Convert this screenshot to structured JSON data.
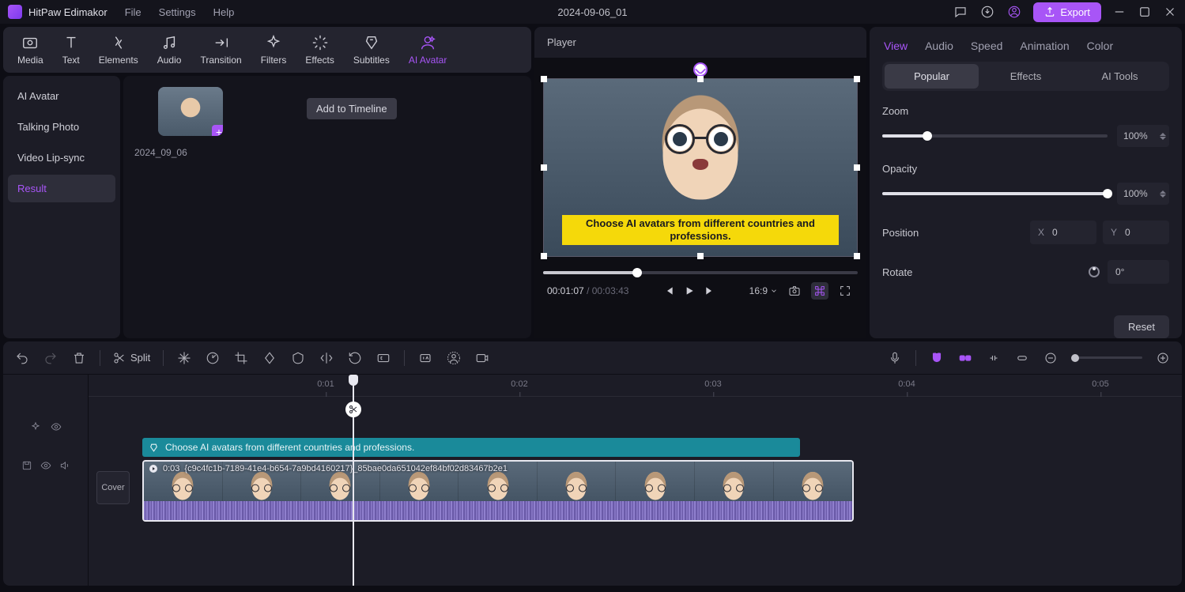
{
  "app": {
    "name": "HitPaw Edimakor",
    "project": "2024-09-06_01"
  },
  "menu": {
    "file": "File",
    "settings": "Settings",
    "help": "Help"
  },
  "export": "Export",
  "toolTabs": {
    "media": "Media",
    "text": "Text",
    "elements": "Elements",
    "audio": "Audio",
    "transition": "Transition",
    "filters": "Filters",
    "effects": "Effects",
    "subtitles": "Subtitles",
    "aiavatar": "AI Avatar"
  },
  "side": {
    "aiAvatar": "AI Avatar",
    "talkingPhoto": "Talking Photo",
    "videoLipSync": "Video Lip-sync",
    "result": "Result"
  },
  "asset": {
    "name": "2024_09_06",
    "tooltip": "Add to Timeline"
  },
  "player": {
    "title": "Player",
    "caption": "Choose AI avatars from different countries and professions.",
    "current": "00:01:07",
    "duration": "00:03:43",
    "aspect": "16:9"
  },
  "props": {
    "tabs": {
      "view": "View",
      "audio": "Audio",
      "speed": "Speed",
      "animation": "Animation",
      "color": "Color"
    },
    "subTabs": {
      "popular": "Popular",
      "effects": "Effects",
      "aitools": "AI Tools"
    },
    "zoom": {
      "label": "Zoom",
      "value": "100%",
      "pct": 20
    },
    "opacity": {
      "label": "Opacity",
      "value": "100%",
      "pct": 100
    },
    "position": {
      "label": "Position",
      "x": "0",
      "y": "0"
    },
    "rotate": {
      "label": "Rotate",
      "value": "0°"
    },
    "reset": "Reset"
  },
  "tlToolbar": {
    "split": "Split"
  },
  "ruler": {
    "t1": "0:01",
    "t2": "0:02",
    "t3": "0:03",
    "t4": "0:04",
    "t5": "0:05"
  },
  "subTrack": "Choose AI avatars from different countries and professions.",
  "clip": {
    "time": "0:03",
    "id": "{c9c4fc1b-7189-41e4-b654-7a9bd4160217}_85bae0da651042ef84bf02d83467b2e1"
  },
  "cover": "Cover"
}
